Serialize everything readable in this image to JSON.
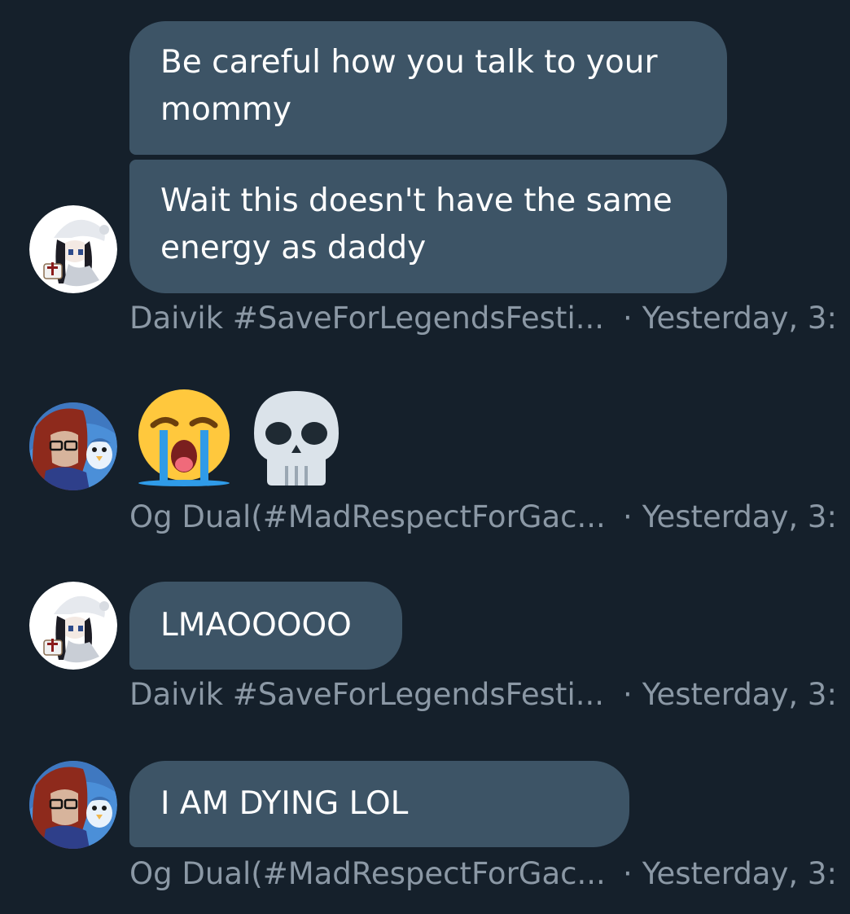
{
  "messages": [
    {
      "bubbles": [
        "Be careful how you talk to your mommy",
        "Wait this doesn't have the same energy as daddy"
      ],
      "author": "Daivik #SaveForLegendsFesti...",
      "separator": "·",
      "time": "Yesterday, 3:",
      "avatar": "white-haired-anime-avatar"
    },
    {
      "emojis": [
        "loudly-crying-face-emoji",
        "skull-emoji"
      ],
      "author": "Og Dual(#MadRespectForGac...",
      "separator": "·",
      "time": "Yesterday, 3:",
      "avatar": "red-haired-glasses-avatar"
    },
    {
      "bubbles": [
        "LMAOOOOO"
      ],
      "author": "Daivik #SaveForLegendsFesti...",
      "separator": "·",
      "time": "Yesterday, 3:",
      "avatar": "white-haired-anime-avatar"
    },
    {
      "bubbles": [
        "I AM DYING LOL"
      ],
      "author": "Og Dual(#MadRespectForGac...",
      "separator": "·",
      "time": "Yesterday, 3:",
      "avatar": "red-haired-glasses-avatar"
    }
  ],
  "colors": {
    "background": "#15202b",
    "bubble": "#3d5466",
    "meta_text": "#8b98a5",
    "bubble_text": "#ffffff"
  }
}
